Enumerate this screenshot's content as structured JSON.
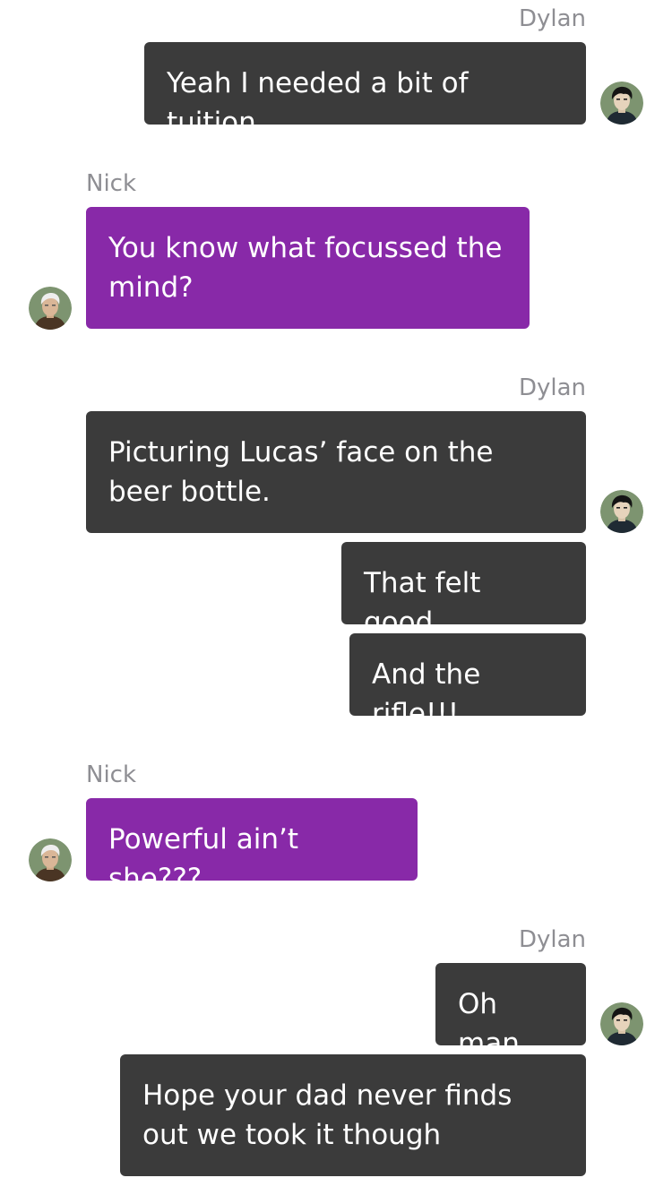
{
  "participants": {
    "dylan": "Dylan",
    "nick": "Nick"
  },
  "messages": [
    {
      "sender": "Dylan",
      "text": "Yeah I needed a bit of tuition."
    },
    {
      "sender": "Nick",
      "text": "You know what focussed the mind?"
    },
    {
      "sender": "Dylan",
      "text": "Picturing Lucas’ face on the beer bottle."
    },
    {
      "sender": "Dylan",
      "text": "That felt good."
    },
    {
      "sender": "Dylan",
      "text": "And the rifle!!!"
    },
    {
      "sender": "Nick",
      "text": "Powerful ain’t she???"
    },
    {
      "sender": "Dylan",
      "text": "Oh man"
    },
    {
      "sender": "Dylan",
      "text": "Hope your dad never finds out we took it though"
    }
  ],
  "colors": {
    "dylan_bubble": "#3b3b3b",
    "nick_bubble": "#8829a8",
    "sender_label": "#8e8e93",
    "background": "#ffffff"
  },
  "icons": {
    "dylan_avatar": "dark-haired-man-avatar-icon",
    "nick_avatar": "white-haired-man-avatar-icon"
  }
}
